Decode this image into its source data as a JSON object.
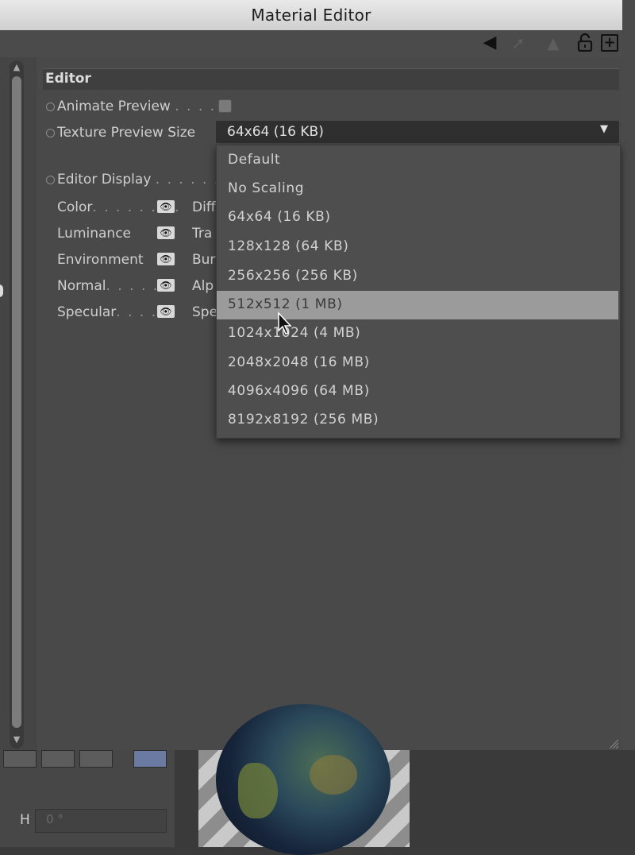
{
  "window": {
    "title": "Material Editor"
  },
  "toolbar": {
    "nav_icon": "back-arrow-icon",
    "lock_icon": "lock-icon",
    "add_icon": "add-icon",
    "add_glyph": "+"
  },
  "editor": {
    "section_title": "Editor",
    "animate_preview": {
      "label": "Animate Preview",
      "dots": ". . . .",
      "checked": false
    },
    "texture_preview_size": {
      "label": "Texture Preview Size",
      "value": "64x64 (16 KB)",
      "options": [
        "Default",
        "No Scaling",
        "64x64 (16 KB)",
        "128x128 (64 KB)",
        "256x256 (256 KB)",
        "512x512 (1 MB)",
        "1024x1024 (4 MB)",
        "2048x2048 (16 MB)",
        "4096x4096 (64 MB)",
        "8192x8192 (256 MB)"
      ],
      "highlighted": "512x512 (1 MB)"
    },
    "editor_display": {
      "label": "Editor Display",
      "dots": ". . . . . .",
      "channels_left": [
        {
          "label": "Color",
          "dots": ". . . . . . . ."
        },
        {
          "label": "Luminance",
          "dots": ""
        },
        {
          "label": "Environment",
          "dots": ""
        },
        {
          "label": "Normal",
          "dots": ". . . . ."
        },
        {
          "label": "Specular",
          "dots": ". . . ."
        }
      ],
      "channels_right_partial": [
        "Diff",
        "Tra",
        "Bur",
        "Alp",
        "Spe"
      ]
    }
  },
  "bottom": {
    "h_label": "H",
    "h_value": "0 °"
  }
}
